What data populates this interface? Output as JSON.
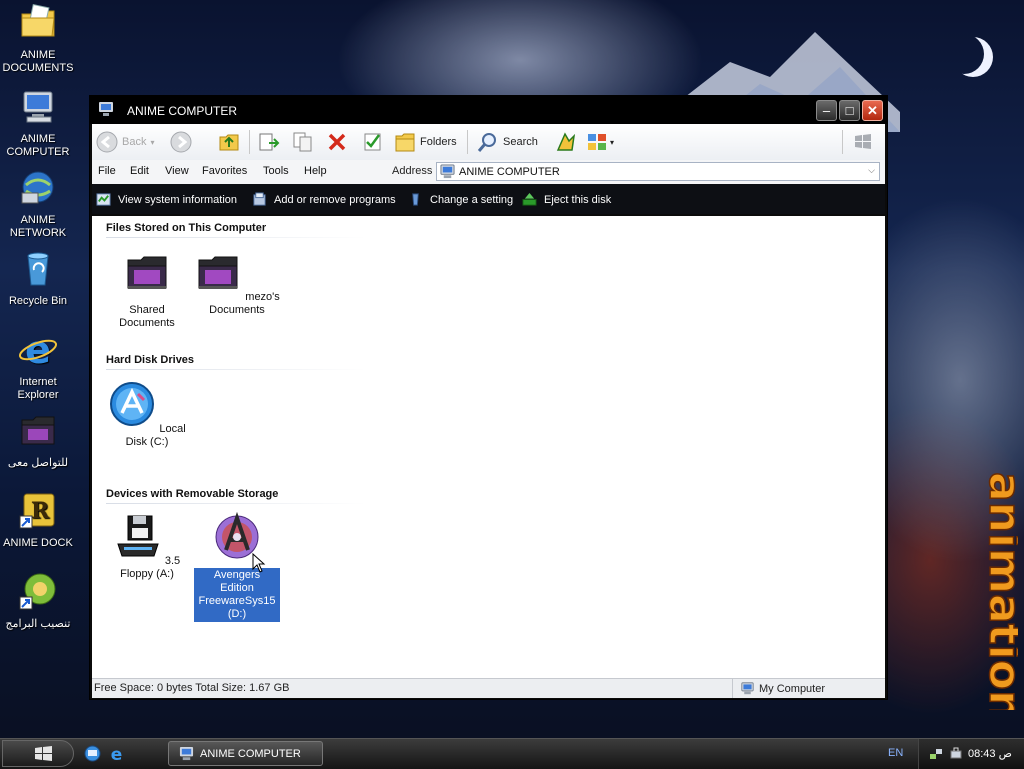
{
  "desktop": {
    "icons": [
      {
        "label": "ANIME DOCUMENTS",
        "icon": "folder-documents-icon"
      },
      {
        "label": "ANIME COMPUTER",
        "icon": "computer-icon"
      },
      {
        "label": "ANIME NETWORK",
        "icon": "network-icon"
      },
      {
        "label": "Recycle Bin",
        "icon": "recycle-bin-icon"
      },
      {
        "label": "Internet Explorer",
        "icon": "internet-explorer-icon"
      },
      {
        "label": "للتواصل معى",
        "icon": "folder-icon"
      },
      {
        "label": "ANIME DOCK",
        "icon": "dock-shortcut-icon"
      },
      {
        "label": "تنصيب البرامج",
        "icon": "installer-shortcut-icon"
      }
    ],
    "wallpaper_text": "animation"
  },
  "window": {
    "title": "ANIME COMPUTER",
    "toolbar": {
      "back_label": "Back",
      "folders_label": "Folders",
      "search_label": "Search"
    },
    "menu": [
      "File",
      "Edit",
      "View",
      "Favorites",
      "Tools",
      "Help"
    ],
    "address": {
      "label": "Address",
      "value": "ANIME COMPUTER"
    },
    "tasks": [
      {
        "label": "View system information",
        "icon": "system-info-icon"
      },
      {
        "label": "Add or remove programs",
        "icon": "add-remove-programs-icon"
      },
      {
        "label": "Change a setting",
        "icon": "control-panel-icon"
      },
      {
        "label": "Eject this disk",
        "icon": "eject-icon"
      }
    ],
    "groups": {
      "files": {
        "title": "Files Stored on This Computer",
        "items": [
          {
            "label": "Shared Documents",
            "icon": "folder-icon"
          },
          {
            "label": "mezo's Documents",
            "icon": "folder-icon"
          }
        ]
      },
      "drives": {
        "title": "Hard Disk Drives",
        "items": [
          {
            "label": "Local Disk (C:)",
            "icon": "hard-disk-icon"
          }
        ]
      },
      "removable": {
        "title": "Devices with Removable Storage",
        "items": [
          {
            "label": "3.5 Floppy (A:)",
            "icon": "floppy-drive-icon"
          },
          {
            "label": "Avengers Edition FreewareSys15 (D:)",
            "icon": "avengers-cd-icon",
            "selected": true
          }
        ]
      }
    },
    "status": {
      "left": "Free Space: 0 bytes Total Size: 1.67 GB",
      "right": "My Computer"
    }
  },
  "taskbar": {
    "task_label": "ANIME COMPUTER",
    "language": "EN",
    "clock": "08:43 ص"
  },
  "colors": {
    "selection": "#316ac5",
    "titlebar": "#000000",
    "close_button": "#c8391b",
    "wallpaper_text": "#f09a1e"
  }
}
